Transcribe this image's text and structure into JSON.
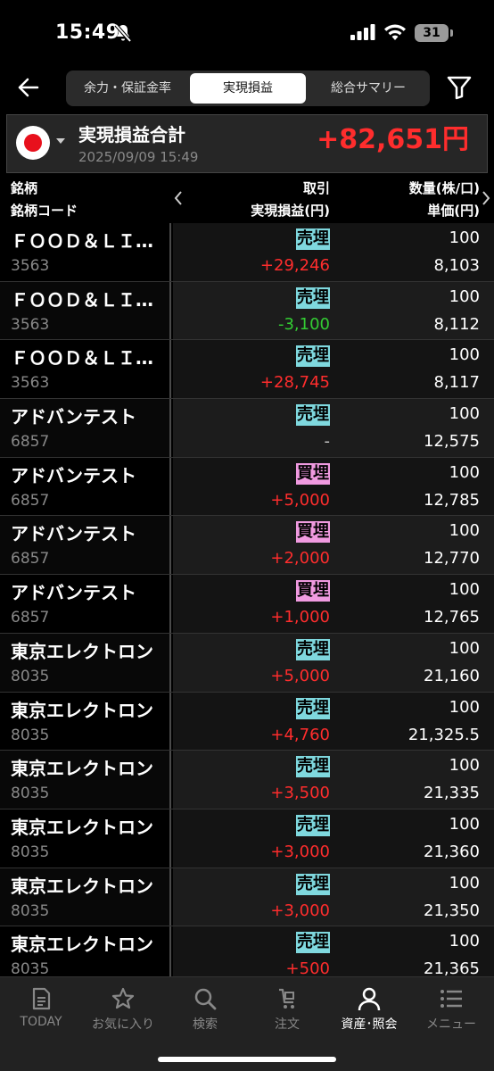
{
  "status_bar": {
    "time": "15:49",
    "battery": "31"
  },
  "nav": {
    "tabs": [
      {
        "label": "余力・保証金率"
      },
      {
        "label": "実現損益"
      },
      {
        "label": "総合サマリー"
      }
    ]
  },
  "summary": {
    "title": "実現損益合計",
    "date": "2025/09/09 15:49",
    "amount": "+82,651円"
  },
  "header": {
    "col1_top": "銘柄",
    "col1_bottom": "銘柄コード",
    "col2_top": "取引",
    "col2_bottom": "実現損益(円)",
    "col3_top": "数量(株/口)",
    "col3_bottom": "単価(円)"
  },
  "rows": [
    {
      "name": "ＦＯＯＤ＆ＬＩ…",
      "code": "3563",
      "type": "売埋",
      "pnl": "+29,246",
      "qty": "100",
      "price": "8,103"
    },
    {
      "name": "ＦＯＯＤ＆ＬＩ…",
      "code": "3563",
      "type": "売埋",
      "pnl": "-3,100",
      "qty": "100",
      "price": "8,112"
    },
    {
      "name": "ＦＯＯＤ＆ＬＩ…",
      "code": "3563",
      "type": "売埋",
      "pnl": "+28,745",
      "qty": "100",
      "price": "8,117"
    },
    {
      "name": "アドバンテスト",
      "code": "6857",
      "type": "売埋",
      "pnl": "-",
      "qty": "100",
      "price": "12,575"
    },
    {
      "name": "アドバンテスト",
      "code": "6857",
      "type": "買埋",
      "pnl": "+5,000",
      "qty": "100",
      "price": "12,785"
    },
    {
      "name": "アドバンテスト",
      "code": "6857",
      "type": "買埋",
      "pnl": "+2,000",
      "qty": "100",
      "price": "12,770"
    },
    {
      "name": "アドバンテスト",
      "code": "6857",
      "type": "買埋",
      "pnl": "+1,000",
      "qty": "100",
      "price": "12,765"
    },
    {
      "name": "東京エレクトロン",
      "code": "8035",
      "type": "売埋",
      "pnl": "+5,000",
      "qty": "100",
      "price": "21,160"
    },
    {
      "name": "東京エレクトロン",
      "code": "8035",
      "type": "売埋",
      "pnl": "+4,760",
      "qty": "100",
      "price": "21,325.5"
    },
    {
      "name": "東京エレクトロン",
      "code": "8035",
      "type": "売埋",
      "pnl": "+3,500",
      "qty": "100",
      "price": "21,335"
    },
    {
      "name": "東京エレクトロン",
      "code": "8035",
      "type": "売埋",
      "pnl": "+3,000",
      "qty": "100",
      "price": "21,360"
    },
    {
      "name": "東京エレクトロン",
      "code": "8035",
      "type": "売埋",
      "pnl": "+3,000",
      "qty": "100",
      "price": "21,350"
    },
    {
      "name": "東京エレクトロン",
      "code": "8035",
      "type": "売埋",
      "pnl": "+500",
      "qty": "100",
      "price": "21,365"
    }
  ],
  "bottom_tabs": [
    {
      "label": "TODAY",
      "icon": "document-icon"
    },
    {
      "label": "お気に入り",
      "icon": "star-icon"
    },
    {
      "label": "検索",
      "icon": "search-icon"
    },
    {
      "label": "注文",
      "icon": "cart-icon"
    },
    {
      "label": "資産･照会",
      "icon": "person-icon"
    },
    {
      "label": "メニュー",
      "icon": "menu-icon"
    }
  ],
  "colors": {
    "profit": "#ff2d2d",
    "loss": "#33cc33",
    "sell_badge": "#7fd8de",
    "buy_badge": "#f09ae0"
  }
}
